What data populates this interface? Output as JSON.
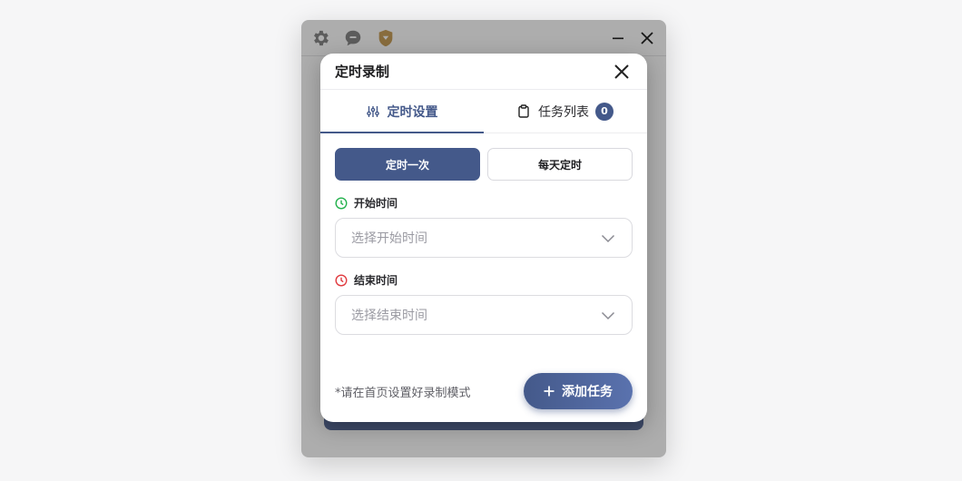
{
  "app": {
    "toolbar_icons": [
      "gear-icon",
      "chat-icon",
      "shield-icon"
    ],
    "window_controls": [
      "minimize-icon",
      "close-icon"
    ]
  },
  "dialog": {
    "title": "定时录制",
    "tabs": [
      {
        "label": "定时设置",
        "icon": "sliders-icon",
        "active": true
      },
      {
        "label": "任务列表",
        "icon": "clipboard-icon",
        "active": false,
        "badge": "0"
      }
    ],
    "modes": [
      {
        "label": "定时一次",
        "active": true
      },
      {
        "label": "每天定时",
        "active": false
      }
    ],
    "start_time": {
      "label": "开始时间",
      "placeholder": "选择开始时间",
      "icon_color": "#22b14c"
    },
    "end_time": {
      "label": "结束时间",
      "placeholder": "选择结束时间",
      "icon_color": "#e0393e"
    },
    "hint": "*请在首页设置好录制模式",
    "add_button": "添加任务"
  },
  "colors": {
    "accent": "#44598a",
    "accent_light": "#5a72ae"
  }
}
